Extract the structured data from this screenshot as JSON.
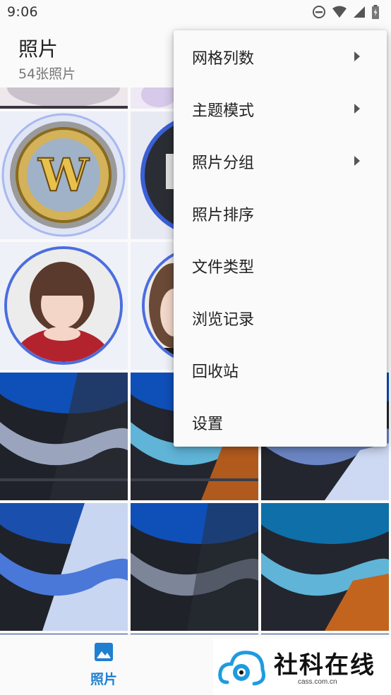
{
  "status_bar": {
    "time": "9:06"
  },
  "header": {
    "title": "照片",
    "subtitle": "54张照片"
  },
  "menu": {
    "items": [
      {
        "label": "网格列数",
        "has_submenu": true
      },
      {
        "label": "主题模式",
        "has_submenu": true
      },
      {
        "label": "照片分组",
        "has_submenu": true
      },
      {
        "label": "照片排序",
        "has_submenu": false
      },
      {
        "label": "文件类型",
        "has_submenu": false
      },
      {
        "label": "浏览记录",
        "has_submenu": false
      },
      {
        "label": "回收站",
        "has_submenu": false
      },
      {
        "label": "设置",
        "has_submenu": false
      }
    ]
  },
  "bottom_nav": {
    "photos_label": "照片",
    "accent": "#1f7fd1"
  },
  "watermark": {
    "title": "社科在线",
    "url": "cass.com.cn"
  }
}
